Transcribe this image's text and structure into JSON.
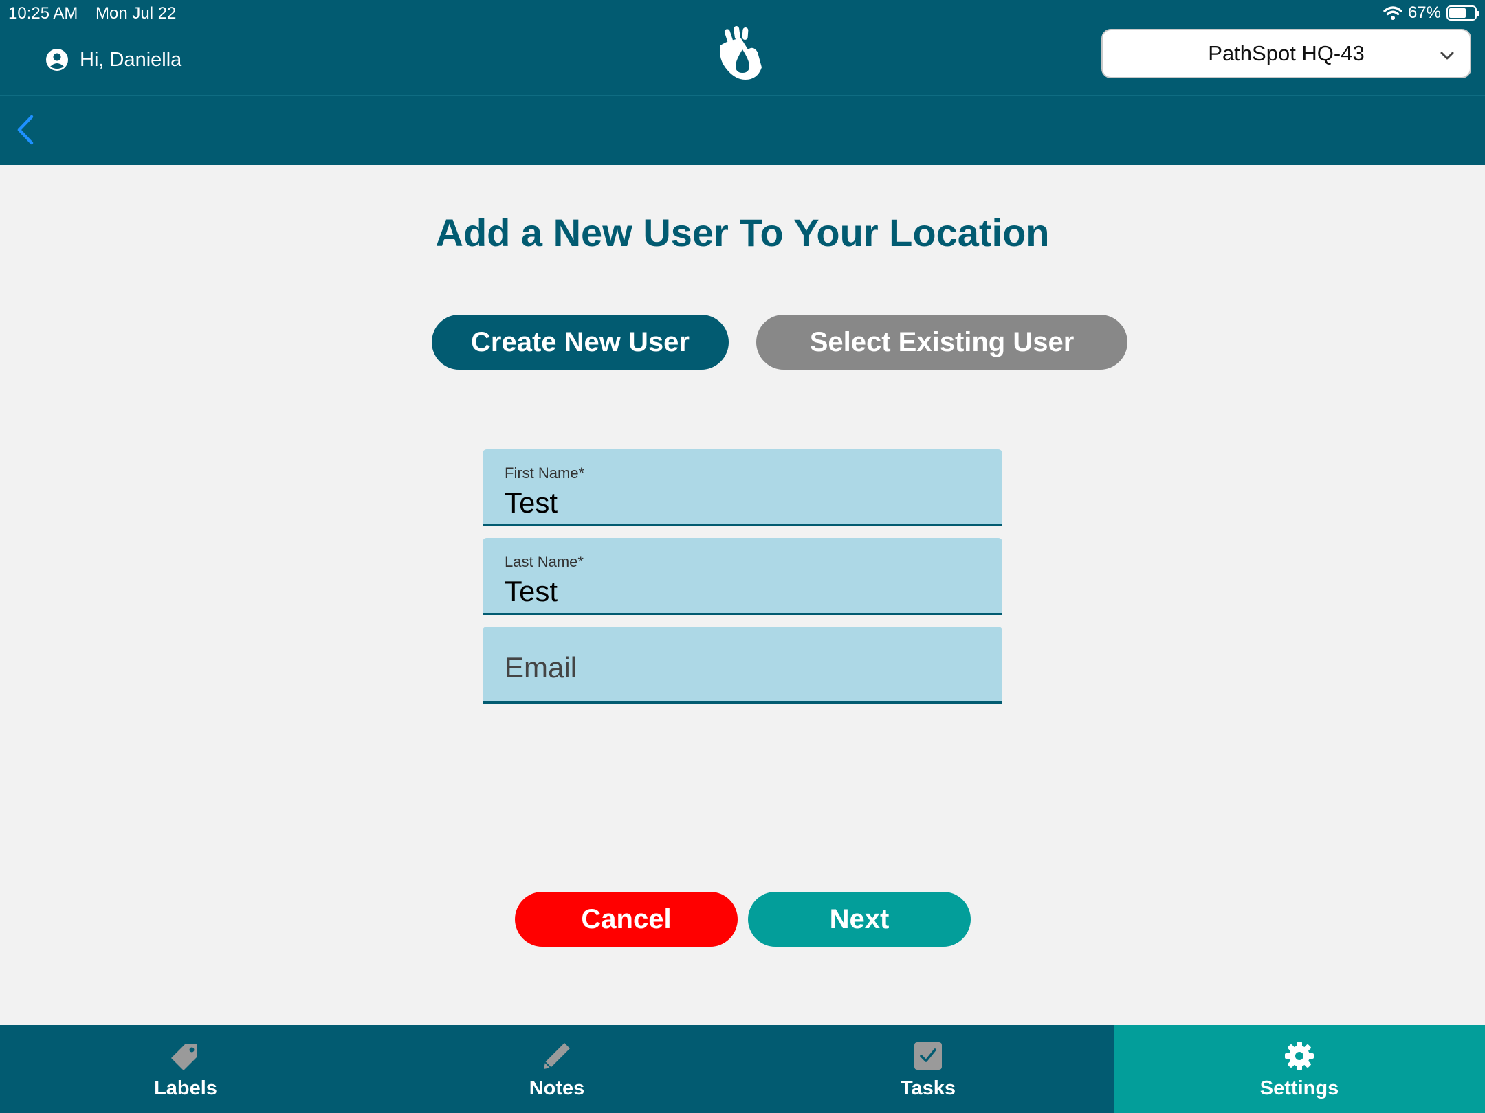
{
  "status_bar": {
    "time": "10:25 AM",
    "date": "Mon Jul 22",
    "battery": "67%",
    "battery_level": 0.67
  },
  "header": {
    "greeting": "Hi, Daniella",
    "location": "PathSpot HQ-43",
    "logo_icon": "pathspot-hand-drop-logo",
    "back_icon": "chevron-left-icon"
  },
  "main": {
    "title": "Add a New User To Your Location",
    "segments": {
      "create": "Create New User",
      "existing": "Select Existing User",
      "selected": "create"
    },
    "form": {
      "first_name": {
        "label": "First Name*",
        "value": "Test"
      },
      "last_name": {
        "label": "Last Name*",
        "value": "Test"
      },
      "email": {
        "placeholder": "Email",
        "value": ""
      }
    },
    "actions": {
      "cancel": "Cancel",
      "next": "Next"
    }
  },
  "tabs": [
    {
      "label": "Labels",
      "icon": "tag-icon",
      "active": false
    },
    {
      "label": "Notes",
      "icon": "pencil-icon",
      "active": false
    },
    {
      "label": "Tasks",
      "icon": "checkbox-icon",
      "active": false
    },
    {
      "label": "Settings",
      "icon": "gear-icon",
      "active": true
    }
  ],
  "colors": {
    "brand": "#025b71",
    "accent": "#039e9a",
    "danger": "#ff0000",
    "field_bg": "#add8e6",
    "inactive_segment": "#888888"
  }
}
